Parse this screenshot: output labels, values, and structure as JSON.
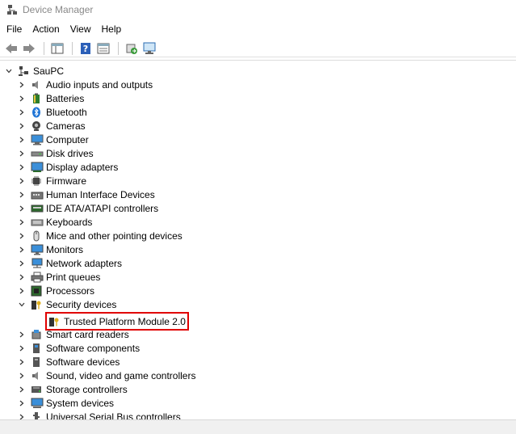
{
  "window": {
    "title": "Device Manager"
  },
  "menu": [
    "File",
    "Action",
    "View",
    "Help"
  ],
  "tree": {
    "root": "SauPC",
    "items": [
      {
        "label": "Audio inputs and outputs",
        "icon": "speaker-icon"
      },
      {
        "label": "Batteries",
        "icon": "battery-icon"
      },
      {
        "label": "Bluetooth",
        "icon": "bluetooth-icon"
      },
      {
        "label": "Cameras",
        "icon": "camera-icon"
      },
      {
        "label": "Computer",
        "icon": "computer-icon"
      },
      {
        "label": "Disk drives",
        "icon": "disk-drive-icon"
      },
      {
        "label": "Display adapters",
        "icon": "display-adapter-icon"
      },
      {
        "label": "Firmware",
        "icon": "chip-icon"
      },
      {
        "label": "Human Interface Devices",
        "icon": "hid-icon"
      },
      {
        "label": "IDE ATA/ATAPI controllers",
        "icon": "ide-controller-icon"
      },
      {
        "label": "Keyboards",
        "icon": "keyboard-icon"
      },
      {
        "label": "Mice and other pointing devices",
        "icon": "mouse-icon"
      },
      {
        "label": "Monitors",
        "icon": "monitor-icon"
      },
      {
        "label": "Network adapters",
        "icon": "network-icon"
      },
      {
        "label": "Print queues",
        "icon": "printer-icon"
      },
      {
        "label": "Processors",
        "icon": "processor-icon"
      },
      {
        "label": "Security devices",
        "icon": "security-device-icon",
        "expanded": true
      },
      {
        "label": "Smart card readers",
        "icon": "smart-card-icon"
      },
      {
        "label": "Software components",
        "icon": "software-component-icon"
      },
      {
        "label": "Software devices",
        "icon": "software-device-icon"
      },
      {
        "label": "Sound, video and game controllers",
        "icon": "sound-icon"
      },
      {
        "label": "Storage controllers",
        "icon": "storage-controller-icon"
      },
      {
        "label": "System devices",
        "icon": "system-device-icon"
      },
      {
        "label": "Universal Serial Bus controllers",
        "icon": "usb-icon"
      }
    ],
    "child": {
      "label": "Trusted Platform Module 2.0",
      "icon": "tpm-key-icon"
    }
  },
  "colors": {
    "highlight": "#e00000",
    "accent": "#1e74d6"
  }
}
